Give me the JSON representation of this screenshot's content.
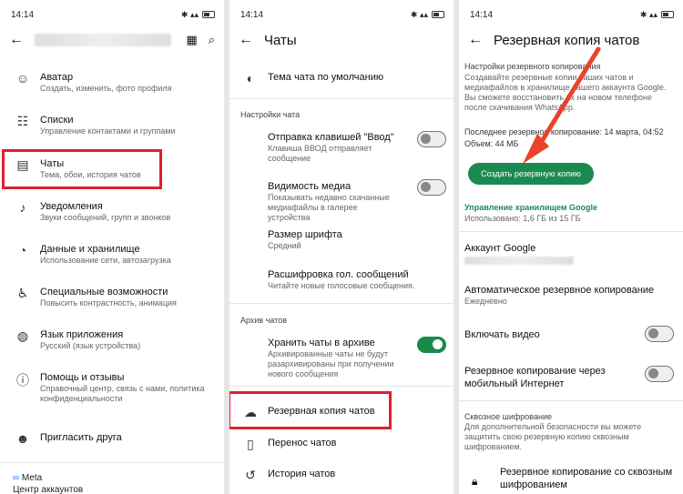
{
  "p1": {
    "time": "14:14",
    "battery": "17",
    "items": [
      {
        "title": "Аватар",
        "sub": "Создать, изменить, фото профиля"
      },
      {
        "title": "Списки",
        "sub": "Управление контактами и группами"
      },
      {
        "title": "Чаты",
        "sub": "Тема, обои, история чатов"
      },
      {
        "title": "Уведомления",
        "sub": "Звуки сообщений, групп и звонков"
      },
      {
        "title": "Данные и хранилище",
        "sub": "Использование сети, автозагрузка"
      },
      {
        "title": "Специальные возможности",
        "sub": "Повысить контрастность, анимация"
      },
      {
        "title": "Язык приложения",
        "sub": "Русский (язык устройства)"
      },
      {
        "title": "Помощь и отзывы",
        "sub": "Справочный центр, связь с нами, политика конфиденциальности"
      },
      {
        "title": "Пригласить друга",
        "sub": ""
      }
    ],
    "meta": "Meta",
    "accounts": "Центр аккаунтов"
  },
  "p2": {
    "time": "14:14",
    "battery": "17",
    "title": "Чаты",
    "theme": "Тема чата по умолчанию",
    "sec1": "Настройки чата",
    "enter_t": "Отправка клавишей \"Ввод\"",
    "enter_s": "Клавиша ВВОД отправляет сообщение",
    "media_t": "Видимость медиа",
    "media_s": "Показывать недавно скачанные медиафайлы в галерее устройства",
    "font_t": "Размер шрифта",
    "font_s": "Средний",
    "voice_t": "Расшифровка гол. сообщений",
    "voice_s": "Читайте новые голосовые сообщения.",
    "sec2": "Архив чатов",
    "arch_t": "Хранить чаты в архиве",
    "arch_s": "Архивированные чаты не будут разархивированы при получении нового сообщения",
    "backup": "Резервная копия чатов",
    "transfer": "Перенос чатов",
    "history": "История чатов"
  },
  "p3": {
    "time": "14:14",
    "battery": "17",
    "title": "Резервная копия чатов",
    "sec1": "Настройки резервного копирования",
    "desc": "Создавайте резервные копии ваших чатов и медиафайлов в хранилище вашего аккаунта Google. Вы сможете восстановить их на новом телефоне после скачивания WhatsApp.",
    "last": "Последнее резервное копирование: 14 марта, 04:52",
    "size": "Объем: 44 МБ",
    "create": "Создать резервную копию",
    "storage_link": "Управление хранилищем Google",
    "storage_used": "Использовано: 1,6 ГБ из 15 ГБ",
    "account": "Аккаунт Google",
    "auto_t": "Автоматическое резервное копирование",
    "auto_s": "Ежедневно",
    "video": "Включать видео",
    "mobile": "Резервное копирование через мобильный Интернет",
    "enc_sec": "Сквозное шифрование",
    "enc_desc": "Для дополнительной безопасности вы можете защитить свою резервную копию сквозным шифрованием.",
    "enc_item": "Резервное копирование со сквозным шифрованием"
  },
  "colors": {
    "accent": "#1b8a50",
    "highlight": "#e0202a"
  }
}
